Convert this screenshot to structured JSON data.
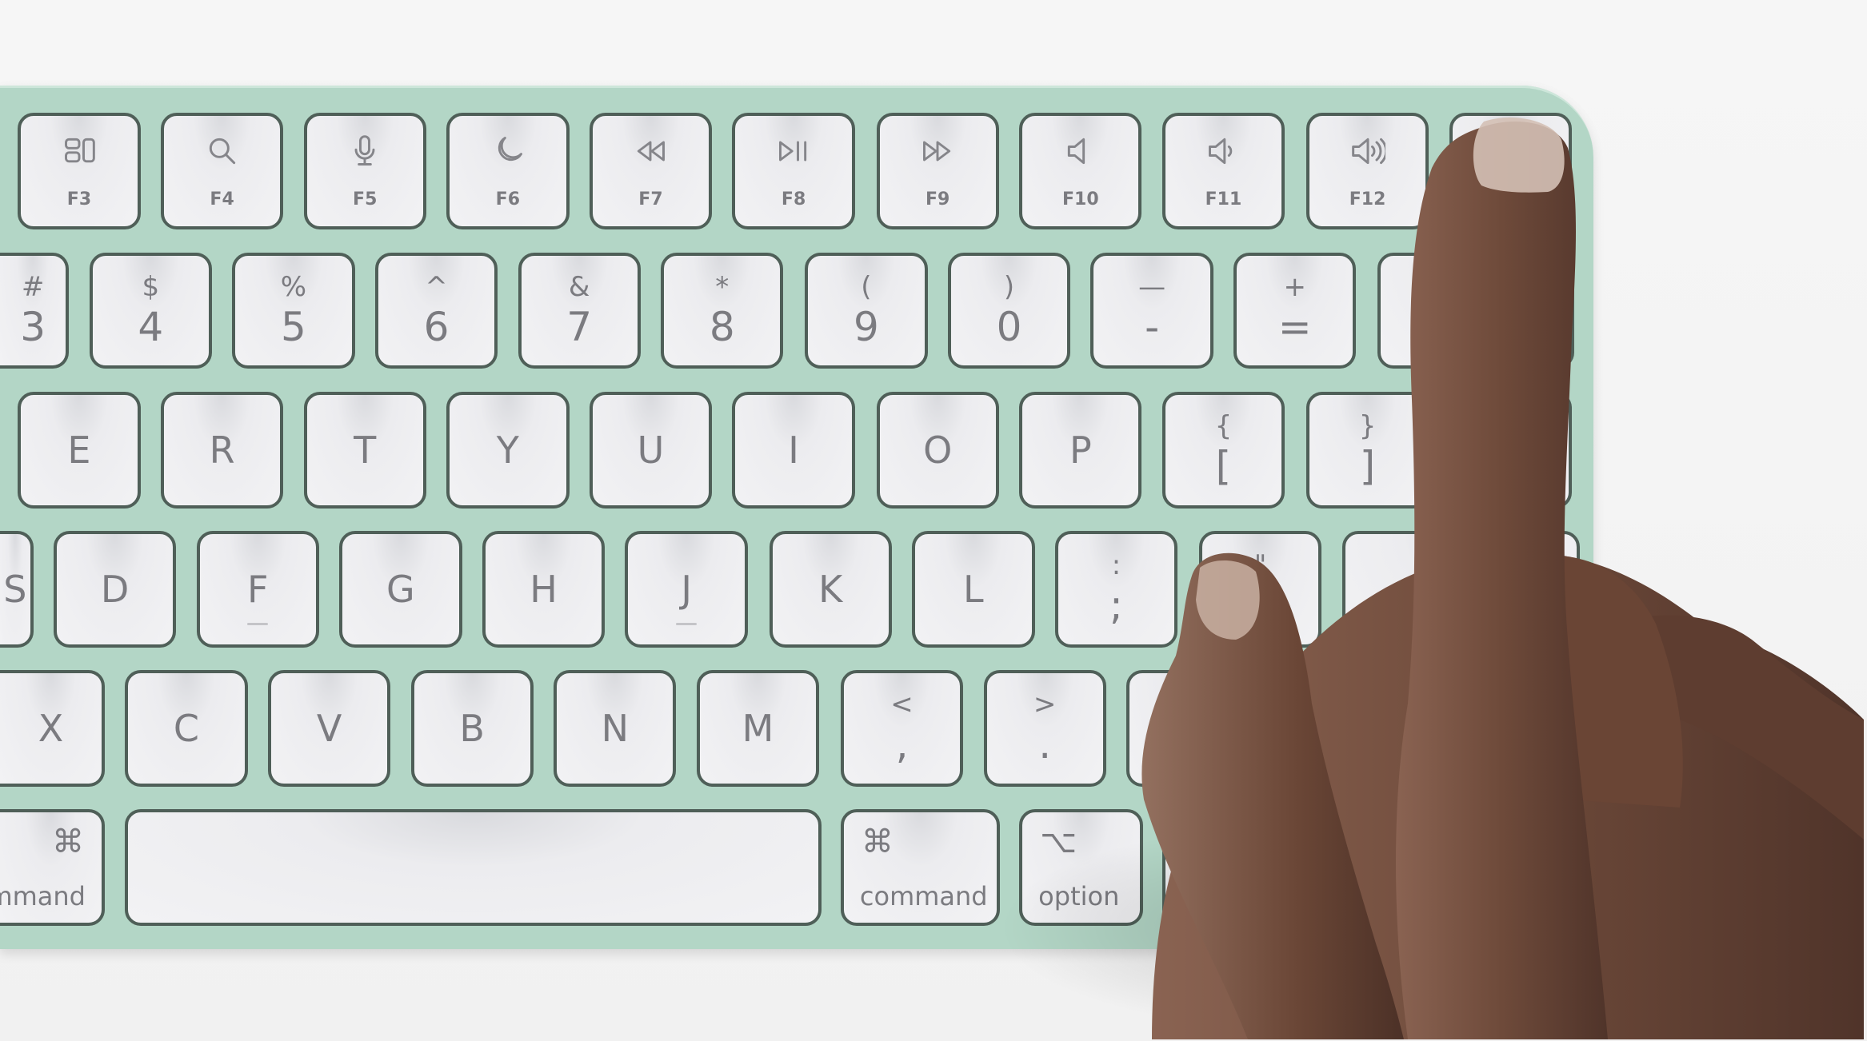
{
  "colors": {
    "keyboard_body": "#b3d6c6",
    "key_face": "#f0f0f2",
    "key_outline": "#4f5f58",
    "legend": "#7b7b80",
    "skin": "#6e4a3a",
    "background": "#f4f4f4"
  },
  "rows": {
    "function": [
      {
        "icon": "mission-control-icon",
        "label": "F3"
      },
      {
        "icon": "search-icon",
        "label": "F4"
      },
      {
        "icon": "microphone-icon",
        "label": "F5"
      },
      {
        "icon": "moon-icon",
        "label": "F6"
      },
      {
        "icon": "rewind-icon",
        "label": "F7"
      },
      {
        "icon": "play-pause-icon",
        "label": "F8"
      },
      {
        "icon": "fast-forward-icon",
        "label": "F9"
      },
      {
        "icon": "mute-icon",
        "label": "F10"
      },
      {
        "icon": "volume-down-icon",
        "label": "F11"
      },
      {
        "icon": "volume-up-icon",
        "label": "F12"
      },
      {
        "icon": "touch-id-icon",
        "label": ""
      }
    ],
    "number": [
      {
        "top": "#",
        "main": "3"
      },
      {
        "top": "$",
        "main": "4"
      },
      {
        "top": "%",
        "main": "5"
      },
      {
        "top": "^",
        "main": "6"
      },
      {
        "top": "&",
        "main": "7"
      },
      {
        "top": "*",
        "main": "8"
      },
      {
        "top": "(",
        "main": "9"
      },
      {
        "top": ")",
        "main": "0"
      },
      {
        "top": "—",
        "main": "-"
      },
      {
        "top": "+",
        "main": "="
      },
      {
        "top": "",
        "main": ""
      }
    ],
    "top_letters": [
      {
        "main": "E"
      },
      {
        "main": "R"
      },
      {
        "main": "T"
      },
      {
        "main": "Y"
      },
      {
        "main": "U"
      },
      {
        "main": "I"
      },
      {
        "main": "O"
      },
      {
        "main": "P"
      },
      {
        "top": "{",
        "main": "["
      },
      {
        "top": "}",
        "main": "]"
      },
      {
        "main": ""
      }
    ],
    "home": [
      {
        "main": "S"
      },
      {
        "main": "D"
      },
      {
        "main": "F",
        "bump": true
      },
      {
        "main": "G"
      },
      {
        "main": "H"
      },
      {
        "main": "J",
        "bump": true
      },
      {
        "main": "K"
      },
      {
        "main": "L"
      },
      {
        "top": ":",
        "main": ";"
      },
      {
        "top": "\"",
        "main": "'"
      },
      {
        "main": ""
      }
    ],
    "bottom_letters": [
      {
        "main": "X"
      },
      {
        "main": "C"
      },
      {
        "main": "V"
      },
      {
        "main": "B"
      },
      {
        "main": "N"
      },
      {
        "main": "M"
      },
      {
        "top": "<",
        "main": ","
      },
      {
        "top": ">",
        "main": "."
      },
      {
        "top": "?",
        "main": "/"
      },
      {
        "main": ""
      }
    ],
    "modifiers": [
      {
        "symbol": "⌘",
        "label": "command",
        "side": "left"
      },
      {
        "symbol": "",
        "label": ""
      },
      {
        "symbol": "⌘",
        "label": "command"
      },
      {
        "symbol": "⌥",
        "label": "option"
      },
      {
        "symbol": "",
        "label": ""
      },
      {
        "up": "▲",
        "down": "▼"
      }
    ]
  }
}
